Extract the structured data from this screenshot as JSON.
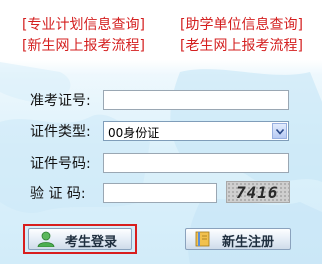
{
  "top_links": [
    {
      "label": "[专业计划信息查询]"
    },
    {
      "label": "[助学单位信息查询]"
    },
    {
      "label": "[新生网上报考流程]"
    },
    {
      "label": "[老生网上报考流程]"
    }
  ],
  "form": {
    "exam_no_label": "准考证号:",
    "exam_no_value": "",
    "id_type_label": "证件类型:",
    "id_type_selected": "00身份证",
    "id_no_label": "证件号码:",
    "id_no_value": "",
    "captcha_label": "验 证 码:",
    "captcha_value": "",
    "captcha_image_text": "7416"
  },
  "buttons": {
    "login_label": "考生登录",
    "register_label": "新生注册"
  },
  "colors": {
    "link_red": "#d42020",
    "highlight_border": "#d81e1e",
    "background_blue": "#d2ecf9"
  },
  "icons": {
    "login": "user-icon",
    "register": "book-icon",
    "dropdown": "chevron-down-icon"
  }
}
